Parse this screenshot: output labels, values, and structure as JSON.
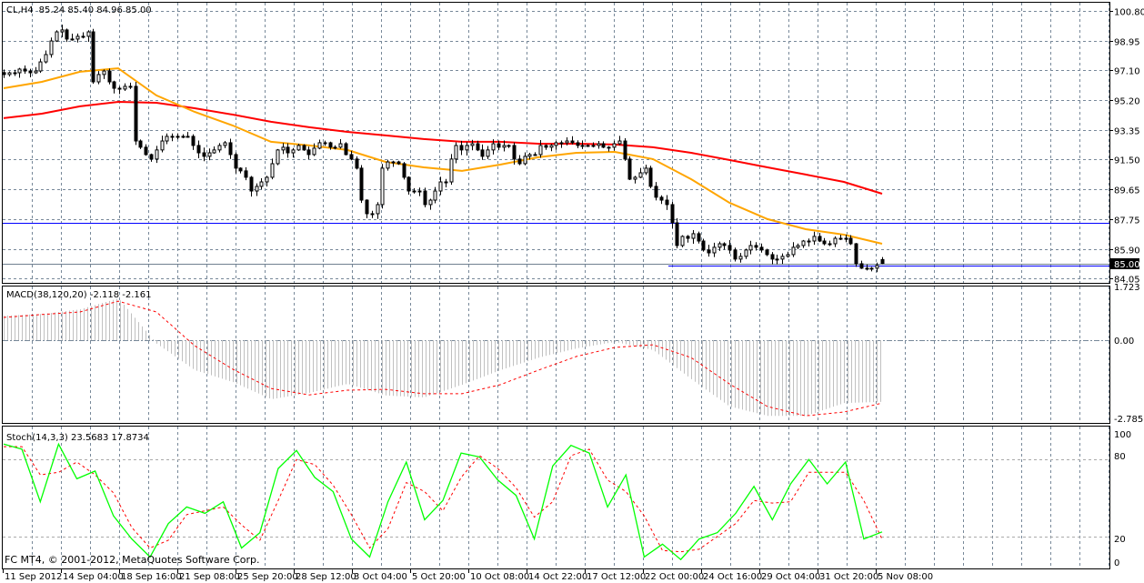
{
  "header": {
    "symbol": "CL,H4",
    "ohlc": "85.24 85.40 84.96 85.00"
  },
  "price_axis": {
    "labels": [
      "100.80",
      "98.95",
      "97.10",
      "95.20",
      "93.35",
      "91.50",
      "89.65",
      "87.75",
      "85.90",
      "84.05"
    ],
    "current": "85.00"
  },
  "macd": {
    "title": "MACD(38,120,20) -2.118 -2.161",
    "axis": [
      "1.723",
      "0.00",
      "-2.785"
    ]
  },
  "stoch": {
    "title": "Stoch(14,3,3) 23.5683 17.8734",
    "axis": [
      "100",
      "80",
      "20",
      "0"
    ]
  },
  "time_axis": [
    "11 Sep 2012",
    "14 Sep 04:00",
    "18 Sep 16:00",
    "21 Sep 08:00",
    "25 Sep 20:00",
    "28 Sep 12:00",
    "3 Oct 04:00",
    "5 Oct 20:00",
    "10 Oct 08:00",
    "14 Oct 22:00",
    "17 Oct 12:00",
    "22 Oct 00:00",
    "24 Oct 16:00",
    "29 Oct 04:00",
    "31 Oct 20:00",
    "5 Nov 08:00"
  ],
  "copyright": "FC MT4, © 2001-2012, MetaQuotes Software Corp.",
  "colors": {
    "ma_fast": "#ffa500",
    "ma_slow": "#ff0000",
    "levels": "#0000ff",
    "stoch_k": "#00ff00",
    "stoch_d": "#ff0000",
    "macd_hist": "#c0c0c0",
    "grid": "#778899"
  },
  "chart_data": {
    "type": "candlestick",
    "symbol": "CL",
    "timeframe": "H4",
    "ylim": [
      84.05,
      100.8
    ],
    "last_bar": {
      "open": 85.24,
      "high": 85.4,
      "low": 84.96,
      "close": 85.0
    },
    "closes": [
      96.82,
      96.93,
      96.93,
      97.16,
      97.04,
      96.93,
      97.04,
      97.61,
      98.07,
      98.92,
      99.49,
      99.61,
      99.04,
      99.04,
      99.21,
      99.21,
      99.49,
      96.36,
      96.82,
      97.04,
      96.36,
      95.96,
      95.91,
      96.08,
      96.08,
      92.66,
      92.27,
      91.81,
      91.53,
      92.1,
      92.66,
      92.95,
      92.95,
      92.95,
      92.95,
      92.95,
      92.38,
      91.92,
      91.7,
      91.92,
      92.1,
      92.38,
      92.55,
      91.81,
      90.96,
      90.79,
      90.39,
      89.53,
      89.82,
      90.1,
      90.39,
      91.24,
      92.1,
      92.27,
      91.92,
      92.1,
      92.38,
      92.1,
      91.81,
      92.21,
      92.55,
      92.55,
      92.27,
      92.27,
      92.49,
      91.81,
      91.53,
      90.96,
      88.96,
      88.11,
      88.11,
      88.68,
      90.96,
      91.35,
      91.35,
      91.24,
      90.39,
      89.53,
      89.53,
      89.53,
      88.68,
      88.96,
      89.53,
      90.1,
      90.1,
      91.53,
      92.38,
      92.1,
      92.38,
      92.49,
      92.1,
      91.7,
      92.1,
      92.49,
      92.27,
      92.38,
      92.38,
      91.53,
      91.24,
      91.7,
      91.81,
      91.81,
      92.38,
      92.27,
      92.38,
      92.55,
      92.55,
      92.66,
      92.55,
      92.38,
      92.38,
      92.38,
      92.38,
      92.49,
      92.27,
      92.27,
      92.49,
      92.66,
      91.53,
      90.27,
      90.39,
      90.67,
      90.96,
      89.82,
      89.14,
      88.96,
      88.68,
      87.54,
      86.12,
      86.69,
      86.57,
      86.86,
      86.4,
      85.84,
      85.66,
      86.01,
      86.23,
      86.12,
      85.84,
      85.27,
      85.44,
      85.84,
      86.12,
      86.01,
      85.84,
      85.55,
      85.27,
      85.27,
      85.44,
      85.55,
      86.01,
      86.12,
      86.4,
      86.4,
      86.69,
      86.4,
      86.23,
      86.23,
      86.57,
      86.57,
      86.57,
      86.23,
      84.98,
      84.7,
      84.64,
      84.7,
      84.87,
      85.0
    ],
    "ma_fast": [
      95.96,
      96.36,
      96.99,
      97.21,
      95.51,
      94.48,
      93.63,
      92.61,
      92.38,
      92.1,
      91.35,
      91.01,
      90.79,
      91.18,
      91.64,
      91.92,
      91.98,
      91.53,
      90.27,
      88.8,
      87.77,
      87.14,
      86.8,
      86.23
    ],
    "ma_slow": [
      94.09,
      94.37,
      94.83,
      95.11,
      95.05,
      94.71,
      94.31,
      93.86,
      93.52,
      93.23,
      93.01,
      92.78,
      92.61,
      92.61,
      92.49,
      92.49,
      92.44,
      92.27,
      91.92,
      91.47,
      91.01,
      90.56,
      90.1,
      89.36
    ],
    "levels": [
      87.55,
      84.84
    ],
    "current_price": 85.0,
    "macd": {
      "ylim": [
        -2.785,
        1.723
      ],
      "main": [
        0.84,
        0.9,
        1.06,
        1.44,
        -0.12,
        -1.03,
        -1.44,
        -2.03,
        -1.81,
        -1.5,
        -1.9,
        -1.97,
        -1.53,
        -1.03,
        -0.6,
        -0.28,
        -0.06,
        -0.34,
        -1.34,
        -2.28,
        -2.6,
        -2.6,
        -2.16,
        -2.118
      ],
      "signal": [
        0.78,
        0.88,
        0.97,
        1.34,
        0.97,
        -0.19,
        -1.0,
        -1.66,
        -1.88,
        -1.72,
        -1.69,
        -1.84,
        -1.84,
        -1.53,
        -1.03,
        -0.56,
        -0.25,
        -0.16,
        -0.6,
        -1.5,
        -2.28,
        -2.6,
        -2.47,
        -2.161
      ]
    },
    "stoch": {
      "ylim": [
        0,
        100
      ],
      "levels": [
        80,
        20
      ],
      "k": [
        92,
        88,
        47,
        92,
        65,
        71,
        36,
        18,
        4,
        30,
        43,
        38,
        47,
        11,
        23,
        73,
        87,
        66,
        55,
        18,
        4,
        47,
        78,
        33,
        48,
        85,
        82,
        64,
        52,
        18,
        75,
        91,
        85,
        43,
        68,
        4,
        14,
        2,
        18,
        23,
        38,
        59,
        33,
        61,
        80,
        61,
        78,
        18,
        23.5683
      ],
      "d": [
        90,
        90,
        68,
        70,
        78,
        68,
        54,
        27,
        11,
        17,
        37,
        40,
        43,
        29,
        17,
        48,
        80,
        76,
        60,
        37,
        11,
        26,
        62,
        55,
        40,
        66,
        83,
        73,
        58,
        35,
        47,
        83,
        88,
        64,
        55,
        36,
        9,
        8,
        10,
        20,
        30,
        48,
        46,
        47,
        70,
        70,
        70,
        48,
        17.8734
      ]
    }
  }
}
